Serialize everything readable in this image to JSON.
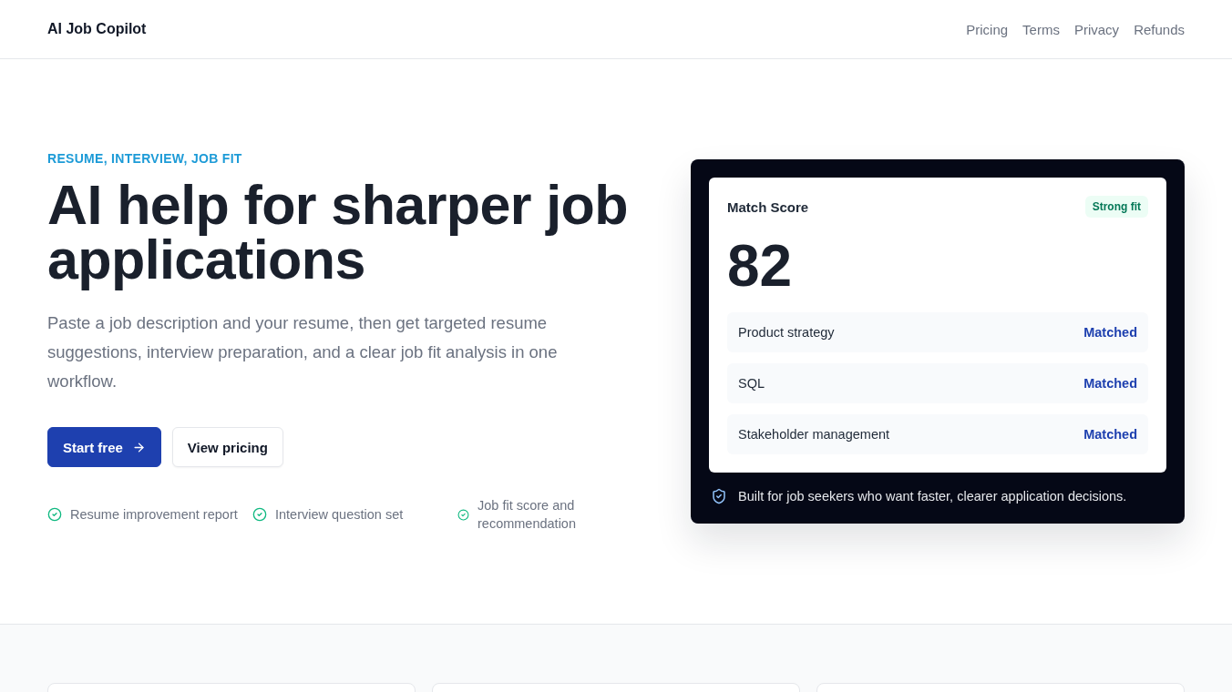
{
  "header": {
    "logo": "AI Job Copilot",
    "nav": [
      "Pricing",
      "Terms",
      "Privacy",
      "Refunds"
    ]
  },
  "hero": {
    "eyebrow": "RESUME, INTERVIEW, JOB FIT",
    "title": "AI help for sharper job applications",
    "description": "Paste a job description and your resume, then get targeted resume suggestions, interview preparation, and a clear job fit analysis in one workflow.",
    "actions": [
      {
        "label": "Start free",
        "kind": "primary"
      },
      {
        "label": "View pricing",
        "kind": "secondary"
      }
    ],
    "features": [
      "Resume improvement report",
      "Interview question set",
      "Job fit score and recommendation"
    ]
  },
  "match_card": {
    "title": "Match Score",
    "badge": "Strong fit",
    "score": "82",
    "skills": [
      {
        "name": "Product strategy",
        "status": "Matched"
      },
      {
        "name": "SQL",
        "status": "Matched"
      },
      {
        "name": "Stakeholder management",
        "status": "Matched"
      }
    ],
    "footnote": "Built for job seekers who want faster, clearer application decisions."
  }
}
